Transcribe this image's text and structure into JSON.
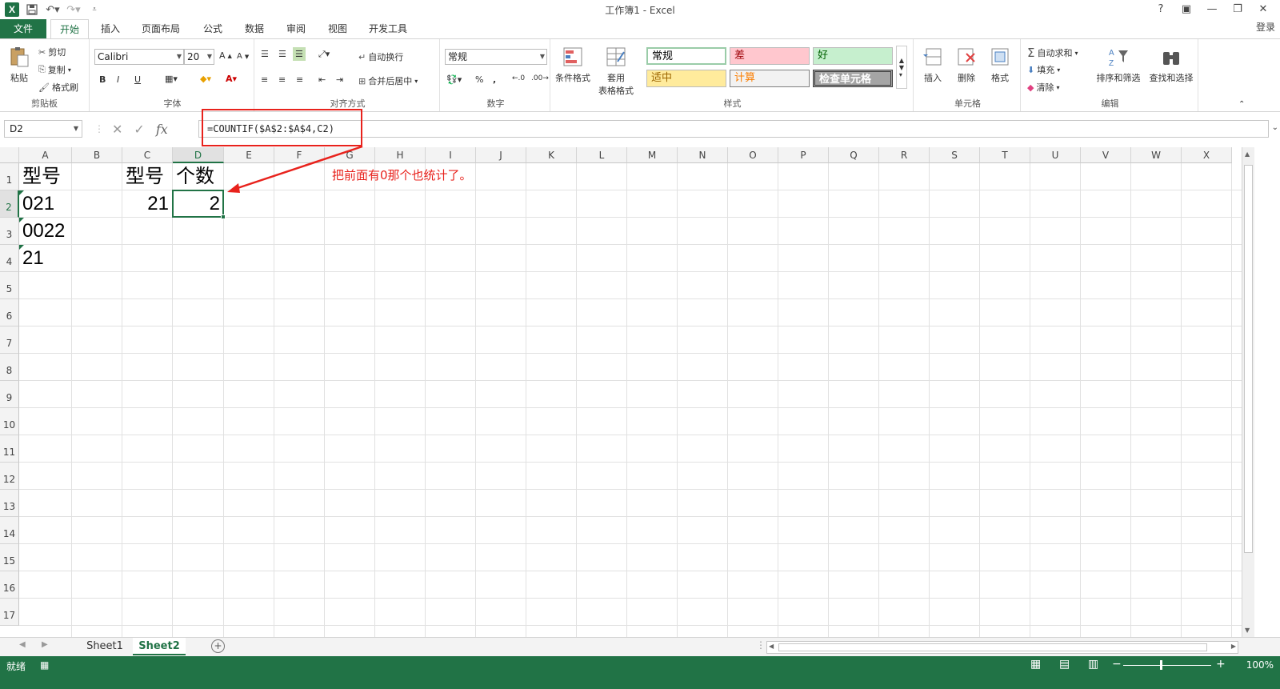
{
  "window": {
    "title": "工作簿1 - Excel",
    "login": "登录"
  },
  "tabs": [
    "文件",
    "开始",
    "插入",
    "页面布局",
    "公式",
    "数据",
    "审阅",
    "视图",
    "开发工具"
  ],
  "ribbon": {
    "clipboard": {
      "paste": "粘贴",
      "cut": "剪切",
      "copy": "复制",
      "format_painter": "格式刷",
      "label": "剪贴板"
    },
    "font": {
      "name": "Calibri",
      "size": "20",
      "label": "字体",
      "bold": "B",
      "italic": "I",
      "underline": "U"
    },
    "alignment": {
      "wrap": "自动换行",
      "merge": "合并后居中",
      "label": "对齐方式"
    },
    "number": {
      "format": "常规",
      "label": "数字",
      "percent": "%",
      "comma": ","
    },
    "styles": {
      "conditional": "条件格式",
      "table_1": "套用",
      "table_2": "表格格式",
      "label": "样式",
      "cells": [
        {
          "text": "常规",
          "bg": "#ffffff",
          "fg": "#000000"
        },
        {
          "text": "差",
          "bg": "#ffc7ce",
          "fg": "#9c0006"
        },
        {
          "text": "好",
          "bg": "#c6efce",
          "fg": "#006100"
        },
        {
          "text": "适中",
          "bg": "#ffeb9c",
          "fg": "#9c6500"
        },
        {
          "text": "计算",
          "bg": "#f2f2f2",
          "fg": "#fa7d00"
        },
        {
          "text": "检查单元格",
          "bg": "#a5a5a5",
          "fg": "#ffffff"
        }
      ]
    },
    "cells": {
      "insert": "插入",
      "delete": "删除",
      "format": "格式",
      "label": "单元格"
    },
    "editing": {
      "autosum": "自动求和",
      "fill": "填充",
      "clear": "清除",
      "sort": "排序和筛选",
      "find": "查找和选择",
      "label": "编辑"
    }
  },
  "formula_bar": {
    "name_box": "D2",
    "fx": "fx",
    "formula": "=COUNTIF($A$2:$A$4,C2)"
  },
  "grid": {
    "columns": [
      "A",
      "B",
      "C",
      "D",
      "E",
      "F",
      "G",
      "H",
      "I",
      "J",
      "K",
      "L",
      "M",
      "N",
      "O",
      "P",
      "Q",
      "R",
      "S",
      "T",
      "U",
      "V",
      "W",
      "X"
    ],
    "rows": [
      "1",
      "2",
      "3",
      "4",
      "5",
      "6",
      "7",
      "8",
      "9",
      "10",
      "11",
      "12",
      "13",
      "14",
      "15",
      "16",
      "17"
    ],
    "cells": {
      "A1": "型号",
      "C1": "型号",
      "D1": "个数",
      "A2": "021",
      "C2": "21",
      "D2": "2",
      "A3": "0022",
      "A4": "21"
    },
    "annotation": "把前面有0那个也统计了。",
    "annotation_color": "#e8221c"
  },
  "sheets": [
    "Sheet1",
    "Sheet2"
  ],
  "active_sheet": "Sheet2",
  "status": {
    "ready": "就绪",
    "zoom": "100%"
  },
  "colors": {
    "accent": "#217346"
  }
}
